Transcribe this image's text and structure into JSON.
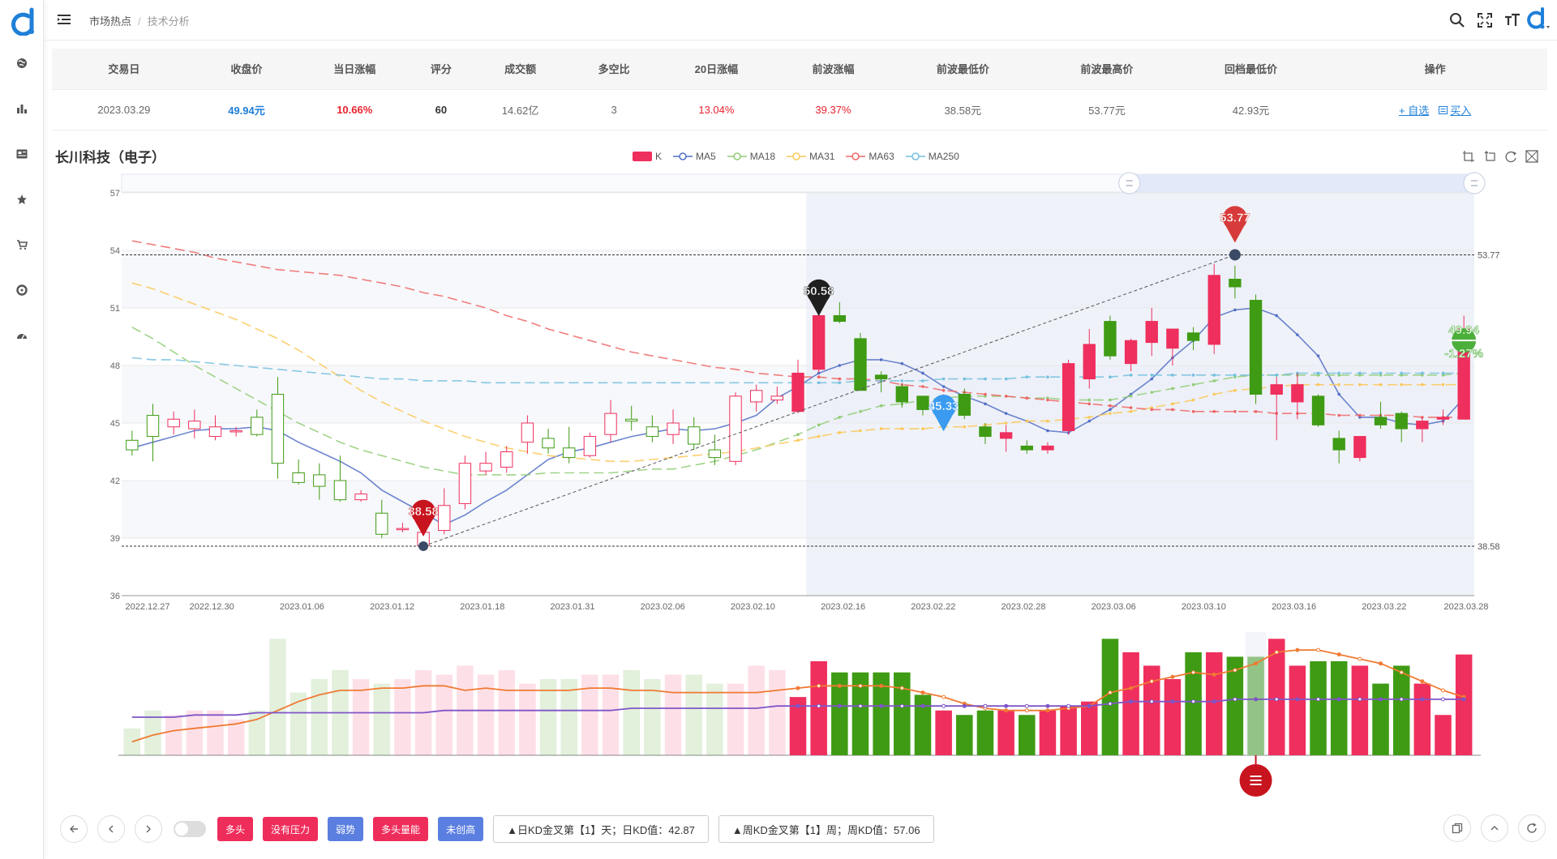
{
  "breadcrumb": {
    "root": "市场热点",
    "current": "技术分析"
  },
  "stats": {
    "headers": [
      "交易日",
      "收盘价",
      "当日涨幅",
      "评分",
      "成交额",
      "多空比",
      "20日涨幅",
      "前波涨幅",
      "前波最低价",
      "前波最高价",
      "回档最低价",
      "操作"
    ],
    "row": {
      "trade_date": "2023.03.29",
      "close": "49.94元",
      "day_change": "10.66%",
      "score": "60",
      "turnover": "14.62亿",
      "long_short": "3",
      "change_20d": "13.04%",
      "prev_wave_change": "39.37%",
      "prev_wave_low": "38.58元",
      "prev_wave_high": "53.77元",
      "pullback_low": "42.93元",
      "actions": {
        "watch": "+ 自选",
        "buy": "买入"
      }
    }
  },
  "chart_title": "长川科技（电子）",
  "colors": {
    "up": "#ef2f5d",
    "down": "#3f9b14",
    "accent": "#1e7fd8"
  },
  "chart_data": {
    "type": "candlestick",
    "legend": [
      "K",
      "MA5",
      "MA18",
      "MA31",
      "MA63",
      "MA250"
    ],
    "ma_colors": [
      "#5470c6",
      "#91cc75",
      "#fac858",
      "#ee6666",
      "#73c0de"
    ],
    "ylim": [
      36,
      57
    ],
    "y_ticks": [
      36,
      39,
      42,
      45,
      48,
      51,
      54,
      57
    ],
    "x_ticks": [
      "2022.12.27",
      "2022.12.30",
      "2023.01.06",
      "2023.01.12",
      "2023.01.18",
      "2023.01.31",
      "2023.02.06",
      "2023.02.10",
      "2023.02.16",
      "2023.02.22",
      "2023.02.28",
      "2023.03.06",
      "2023.03.10",
      "2023.03.16",
      "2023.03.22",
      "2023.03.28"
    ],
    "candles": [
      [
        44.1,
        43.6,
        43.3,
        44.6
      ],
      [
        45.4,
        44.3,
        43.0,
        46.0
      ],
      [
        44.8,
        45.2,
        44.4,
        45.6
      ],
      [
        44.7,
        45.1,
        44.2,
        45.7
      ],
      [
        44.3,
        44.8,
        44.1,
        45.4
      ],
      [
        44.6,
        44.6,
        44.3,
        44.8
      ],
      [
        45.3,
        44.4,
        44.3,
        45.7
      ],
      [
        46.5,
        42.9,
        42.1,
        47.4
      ],
      [
        42.4,
        41.9,
        41.8,
        43.1
      ],
      [
        42.3,
        41.7,
        41.0,
        42.9
      ],
      [
        42.0,
        41.0,
        40.9,
        43.3
      ],
      [
        41.0,
        41.3,
        40.9,
        41.5
      ],
      [
        40.3,
        39.2,
        39.0,
        41.0
      ],
      [
        39.5,
        39.5,
        39.3,
        39.8
      ],
      [
        38.6,
        39.3,
        38.6,
        40.8
      ],
      [
        39.4,
        40.7,
        39.2,
        41.6
      ],
      [
        40.8,
        42.9,
        40.5,
        43.3
      ],
      [
        42.5,
        42.9,
        42.3,
        43.5
      ],
      [
        42.7,
        43.5,
        42.4,
        43.8
      ],
      [
        44.0,
        45.0,
        43.4,
        45.4
      ],
      [
        44.2,
        43.7,
        43.4,
        44.7
      ],
      [
        43.7,
        43.2,
        42.9,
        44.8
      ],
      [
        43.3,
        44.3,
        43.2,
        44.5
      ],
      [
        44.4,
        45.5,
        44.0,
        46.2
      ],
      [
        45.2,
        45.1,
        44.6,
        45.9
      ],
      [
        44.8,
        44.3,
        44.0,
        45.4
      ],
      [
        44.4,
        45.0,
        43.9,
        45.7
      ],
      [
        44.8,
        43.9,
        43.6,
        45.3
      ],
      [
        43.6,
        43.2,
        42.8,
        44.4
      ],
      [
        43.0,
        46.4,
        42.8,
        46.6
      ],
      [
        46.1,
        46.7,
        45.6,
        47.0
      ],
      [
        46.2,
        46.4,
        46.0,
        46.9
      ],
      [
        45.6,
        47.6,
        45.5,
        48.3
      ],
      [
        47.8,
        50.6,
        47.6,
        50.6
      ],
      [
        50.6,
        50.3,
        50.2,
        51.3
      ],
      [
        49.4,
        46.7,
        46.7,
        49.7
      ],
      [
        47.5,
        47.3,
        46.6,
        47.7
      ],
      [
        46.9,
        46.1,
        45.8,
        47.0
      ],
      [
        46.4,
        45.7,
        45.4,
        46.4
      ],
      [
        46.2,
        46.2,
        45.8,
        46.5
      ],
      [
        46.5,
        45.4,
        45.2,
        46.8
      ],
      [
        44.8,
        44.3,
        43.9,
        45.0
      ],
      [
        44.2,
        44.5,
        43.5,
        44.9
      ],
      [
        43.8,
        43.6,
        43.4,
        44.1
      ],
      [
        43.6,
        43.8,
        43.4,
        44.0
      ],
      [
        44.6,
        48.1,
        44.4,
        48.3
      ],
      [
        47.3,
        49.1,
        46.8,
        49.9
      ],
      [
        50.3,
        48.5,
        48.3,
        50.6
      ],
      [
        48.1,
        49.3,
        47.7,
        49.4
      ],
      [
        49.2,
        50.3,
        48.5,
        51.0
      ],
      [
        48.9,
        49.9,
        48.0,
        49.9
      ],
      [
        49.7,
        49.3,
        48.8,
        50.0
      ],
      [
        49.1,
        52.7,
        48.6,
        53.3
      ],
      [
        52.5,
        52.1,
        51.5,
        53.2
      ],
      [
        51.4,
        46.5,
        46.0,
        51.7
      ],
      [
        46.5,
        47.0,
        44.1,
        47.4
      ],
      [
        46.1,
        47.0,
        45.2,
        47.6
      ],
      [
        46.4,
        44.9,
        44.8,
        46.5
      ],
      [
        44.2,
        43.6,
        42.9,
        44.6
      ],
      [
        43.2,
        44.3,
        43.0,
        44.3
      ],
      [
        45.3,
        44.9,
        44.7,
        46.1
      ],
      [
        45.5,
        44.7,
        44.0,
        45.6
      ],
      [
        44.7,
        45.1,
        44.0,
        45.3
      ],
      [
        45.2,
        45.3,
        44.9,
        45.7
      ],
      [
        45.2,
        49.9,
        45.2,
        50.6
      ]
    ],
    "ma5": [
      43.7,
      44.0,
      44.3,
      44.6,
      44.7,
      44.7,
      44.8,
      44.6,
      44.0,
      43.5,
      43.0,
      42.4,
      41.5,
      40.9,
      40.3,
      39.7,
      40.2,
      40.9,
      41.5,
      42.3,
      43.1,
      43.5,
      43.7,
      44.0,
      44.3,
      44.5,
      44.7,
      44.6,
      44.7,
      45.0,
      45.4,
      46.3,
      46.9,
      47.6,
      48.0,
      48.3,
      48.3,
      48.1,
      47.6,
      46.9,
      46.4,
      46.0,
      45.5,
      45.1,
      44.6,
      44.5,
      45.1,
      45.7,
      46.5,
      47.3,
      48.4,
      49.3,
      50.5,
      50.9,
      51.0,
      50.6,
      49.6,
      48.5,
      46.5,
      45.3,
      45.3,
      45.0,
      44.9,
      45.1,
      46.3
    ],
    "ma18": [
      50.0,
      49.4,
      48.7,
      48.0,
      47.4,
      46.8,
      46.2,
      45.6,
      45.0,
      44.5,
      44.0,
      43.6,
      43.3,
      43.0,
      42.7,
      42.5,
      42.3,
      42.3,
      42.3,
      42.3,
      42.4,
      42.4,
      42.4,
      42.4,
      42.5,
      42.6,
      42.6,
      42.8,
      43.0,
      43.3,
      43.6,
      44.0,
      44.4,
      44.9,
      45.3,
      45.6,
      45.9,
      46.0,
      46.2,
      46.3,
      46.4,
      46.4,
      46.4,
      46.3,
      46.3,
      46.2,
      46.2,
      46.2,
      46.4,
      46.6,
      46.8,
      47.0,
      47.2,
      47.4,
      47.5,
      47.5,
      47.5,
      47.5,
      47.5,
      47.5,
      47.5,
      47.5,
      47.5,
      47.5,
      47.6
    ],
    "ma31": [
      52.3,
      52.0,
      51.6,
      51.2,
      50.8,
      50.4,
      49.9,
      49.4,
      48.8,
      48.1,
      47.4,
      46.7,
      46.1,
      45.6,
      45.1,
      44.7,
      44.3,
      44.0,
      43.7,
      43.5,
      43.3,
      43.2,
      43.1,
      43.0,
      43.0,
      43.1,
      43.2,
      43.3,
      43.4,
      43.5,
      43.7,
      43.9,
      44.1,
      44.3,
      44.5,
      44.6,
      44.7,
      44.7,
      44.7,
      44.8,
      44.8,
      44.9,
      45.0,
      45.1,
      45.1,
      45.2,
      45.3,
      45.5,
      45.6,
      45.8,
      46.0,
      46.2,
      46.5,
      46.7,
      46.8,
      46.9,
      47.0,
      47.0,
      47.0,
      47.0,
      47.0,
      47.0,
      47.0,
      47.0,
      47.0
    ],
    "ma63": [
      54.5,
      54.3,
      54.1,
      53.9,
      53.6,
      53.4,
      53.2,
      53.0,
      52.9,
      52.8,
      52.7,
      52.5,
      52.3,
      52.1,
      51.8,
      51.6,
      51.3,
      51.0,
      50.6,
      50.3,
      49.9,
      49.6,
      49.3,
      49.0,
      48.7,
      48.5,
      48.3,
      48.1,
      47.9,
      47.8,
      47.6,
      47.5,
      47.4,
      47.4,
      47.3,
      47.3,
      47.2,
      47.0,
      46.9,
      46.7,
      46.6,
      46.5,
      46.4,
      46.3,
      46.2,
      46.1,
      46.0,
      45.9,
      45.8,
      45.7,
      45.7,
      45.6,
      45.6,
      45.6,
      45.6,
      45.5,
      45.5,
      45.5,
      45.4,
      45.4,
      45.4,
      45.4,
      45.3,
      45.3,
      45.3
    ],
    "ma250": [
      48.4,
      48.3,
      48.3,
      48.2,
      48.1,
      48.0,
      47.9,
      47.8,
      47.7,
      47.6,
      47.5,
      47.4,
      47.3,
      47.3,
      47.2,
      47.2,
      47.2,
      47.1,
      47.1,
      47.1,
      47.1,
      47.1,
      47.1,
      47.1,
      47.1,
      47.1,
      47.1,
      47.1,
      47.1,
      47.1,
      47.1,
      47.1,
      47.1,
      47.1,
      47.1,
      47.2,
      47.2,
      47.2,
      47.2,
      47.3,
      47.3,
      47.3,
      47.3,
      47.4,
      47.4,
      47.4,
      47.4,
      47.4,
      47.5,
      47.5,
      47.5,
      47.5,
      47.5,
      47.5,
      47.5,
      47.5,
      47.6,
      47.6,
      47.6,
      47.6,
      47.6,
      47.6,
      47.6,
      47.6,
      47.6
    ],
    "volume": [
      12,
      20,
      18,
      20,
      20,
      16,
      20,
      52,
      28,
      34,
      38,
      34,
      32,
      34,
      38,
      36,
      40,
      36,
      38,
      32,
      34,
      34,
      36,
      36,
      38,
      34,
      36,
      36,
      32,
      32,
      40,
      38,
      26,
      42,
      37,
      37,
      37,
      37,
      27,
      20,
      18,
      20,
      20,
      18,
      20,
      22,
      24,
      52,
      46,
      40,
      34,
      46,
      46,
      44,
      44,
      52,
      40,
      42,
      42,
      40,
      32,
      40,
      32,
      18,
      45
    ],
    "vol_shaded_count": 32,
    "vol_ma_fast": [
      6,
      9,
      11,
      12,
      13,
      14,
      16,
      20,
      24,
      27,
      29,
      29,
      30,
      30,
      31,
      31,
      29,
      30,
      29,
      29,
      29,
      29,
      30,
      30,
      29,
      29,
      28,
      28,
      28,
      28,
      28,
      29,
      30,
      31,
      31,
      31,
      31,
      30,
      28,
      26,
      23,
      21,
      20,
      20,
      20,
      21,
      22,
      28,
      30,
      33,
      35,
      37,
      36,
      38,
      41,
      46,
      47,
      47,
      45,
      43,
      41,
      37,
      33,
      29,
      26
    ],
    "vol_ma_slow": [
      17,
      17,
      17,
      18,
      18,
      18,
      19,
      19,
      19,
      19,
      19,
      19,
      19,
      19,
      19,
      20,
      20,
      20,
      20,
      20,
      20,
      20,
      20,
      20,
      21,
      21,
      21,
      21,
      21,
      21,
      21,
      22,
      22,
      22,
      22,
      22,
      22,
      22,
      22,
      22,
      22,
      22,
      22,
      22,
      22,
      22,
      22,
      23,
      24,
      24,
      24,
      24,
      24,
      25,
      25,
      25,
      25,
      25,
      25,
      25,
      25,
      25,
      25,
      25,
      25
    ],
    "markers": {
      "low": {
        "value": "38.58",
        "index": 14,
        "price": 38.58
      },
      "high": {
        "value": "53.77",
        "index": 53,
        "price": 53.77
      },
      "point_a": {
        "value": "50.58",
        "index": 33,
        "price": 50.58
      },
      "point_b": {
        "value": "45.33",
        "index": 39,
        "price": 45.33
      },
      "last": {
        "value": "49.94",
        "pct": "-1.27%",
        "index": 64,
        "price": 49.94
      }
    },
    "hline_labels": {
      "top": "53.77",
      "bottom": "38.58"
    },
    "zoom_start_index": 32
  },
  "toolbar": {
    "tags": [
      {
        "label": "多头",
        "style": "red"
      },
      {
        "label": "没有压力",
        "style": "red"
      },
      {
        "label": "弱势",
        "style": "blue"
      },
      {
        "label": "多头量能",
        "style": "red"
      },
      {
        "label": "未创高",
        "style": "blue"
      }
    ],
    "signals": [
      "▲日KD金叉第【1】天；日KD值：42.87",
      "▲周KD金叉第【1】周；周KD值：57.06"
    ]
  }
}
